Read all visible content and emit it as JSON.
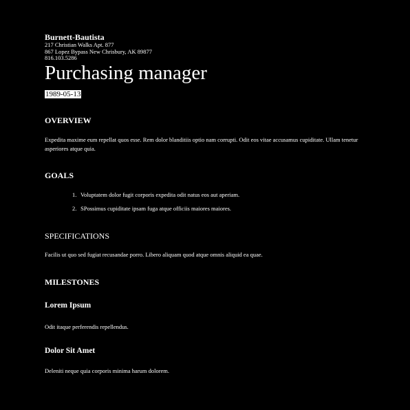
{
  "header": {
    "company": "Burnett-Bautista",
    "address_lines": [
      "217 Christian Walks Apt. 877",
      "867 Lopez Bypass New Chrisbury, AK 89877",
      "816.103.5286"
    ],
    "title": "Purchasing manager",
    "date": "1989-05-13"
  },
  "overview": {
    "heading": "OVERVIEW",
    "text": "Expedita maxime eum repellat quos esse. Rem dolor blanditiis optio nam corrupti. Odit eos vitae accusamus cupiditate. Ullam tenetur asperiores atque quia."
  },
  "goals": {
    "heading": "GOALS",
    "items": [
      {
        "num": "1.",
        "text": "Voluptatem dolor fugit corporis expedita odit natus eos aut aperiam."
      },
      {
        "num": "2.",
        "text": "SPossimus cupiditate ipsam fuga atque officiis maiores maiores."
      }
    ]
  },
  "specifications": {
    "heading": "SPECIFICATIONS",
    "text": "Facilis ut quo sed fugiat recusandae porro. Libero aliquam quod atque omnis aliquid ea quae."
  },
  "milestones": {
    "heading": "MILESTONES",
    "items": [
      {
        "title": "Lorem Ipsum",
        "text": "Odit itaque perferendis repellendus."
      },
      {
        "title": "Dolor Sit Amet",
        "text": "Deleniti neque quia corporis minima harum dolorem."
      }
    ]
  }
}
